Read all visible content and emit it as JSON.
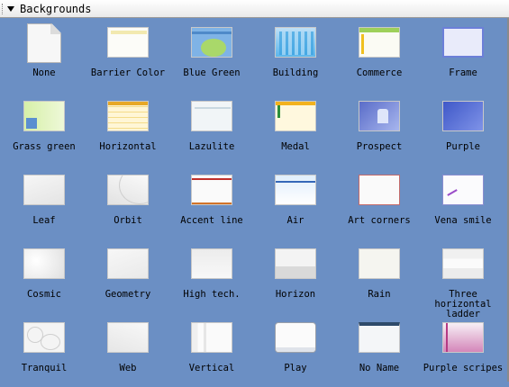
{
  "panel": {
    "title": "Backgrounds"
  },
  "backgrounds": [
    "None",
    "Barrier Color",
    "Blue Green",
    "Building",
    "Commerce",
    "Frame",
    "Grass green",
    "Horizontal",
    "Lazulite",
    "Medal",
    "Prospect",
    "Purple",
    "Leaf",
    "Orbit",
    "Accent line",
    "Air",
    "Art corners",
    "Vena smile",
    "Cosmic",
    "Geometry",
    "High tech.",
    "Horizon",
    "Rain",
    "Three horizontal ladder",
    "Tranquil",
    "Web",
    "Vertical",
    "Play",
    "No Name",
    "Purple scripes"
  ]
}
